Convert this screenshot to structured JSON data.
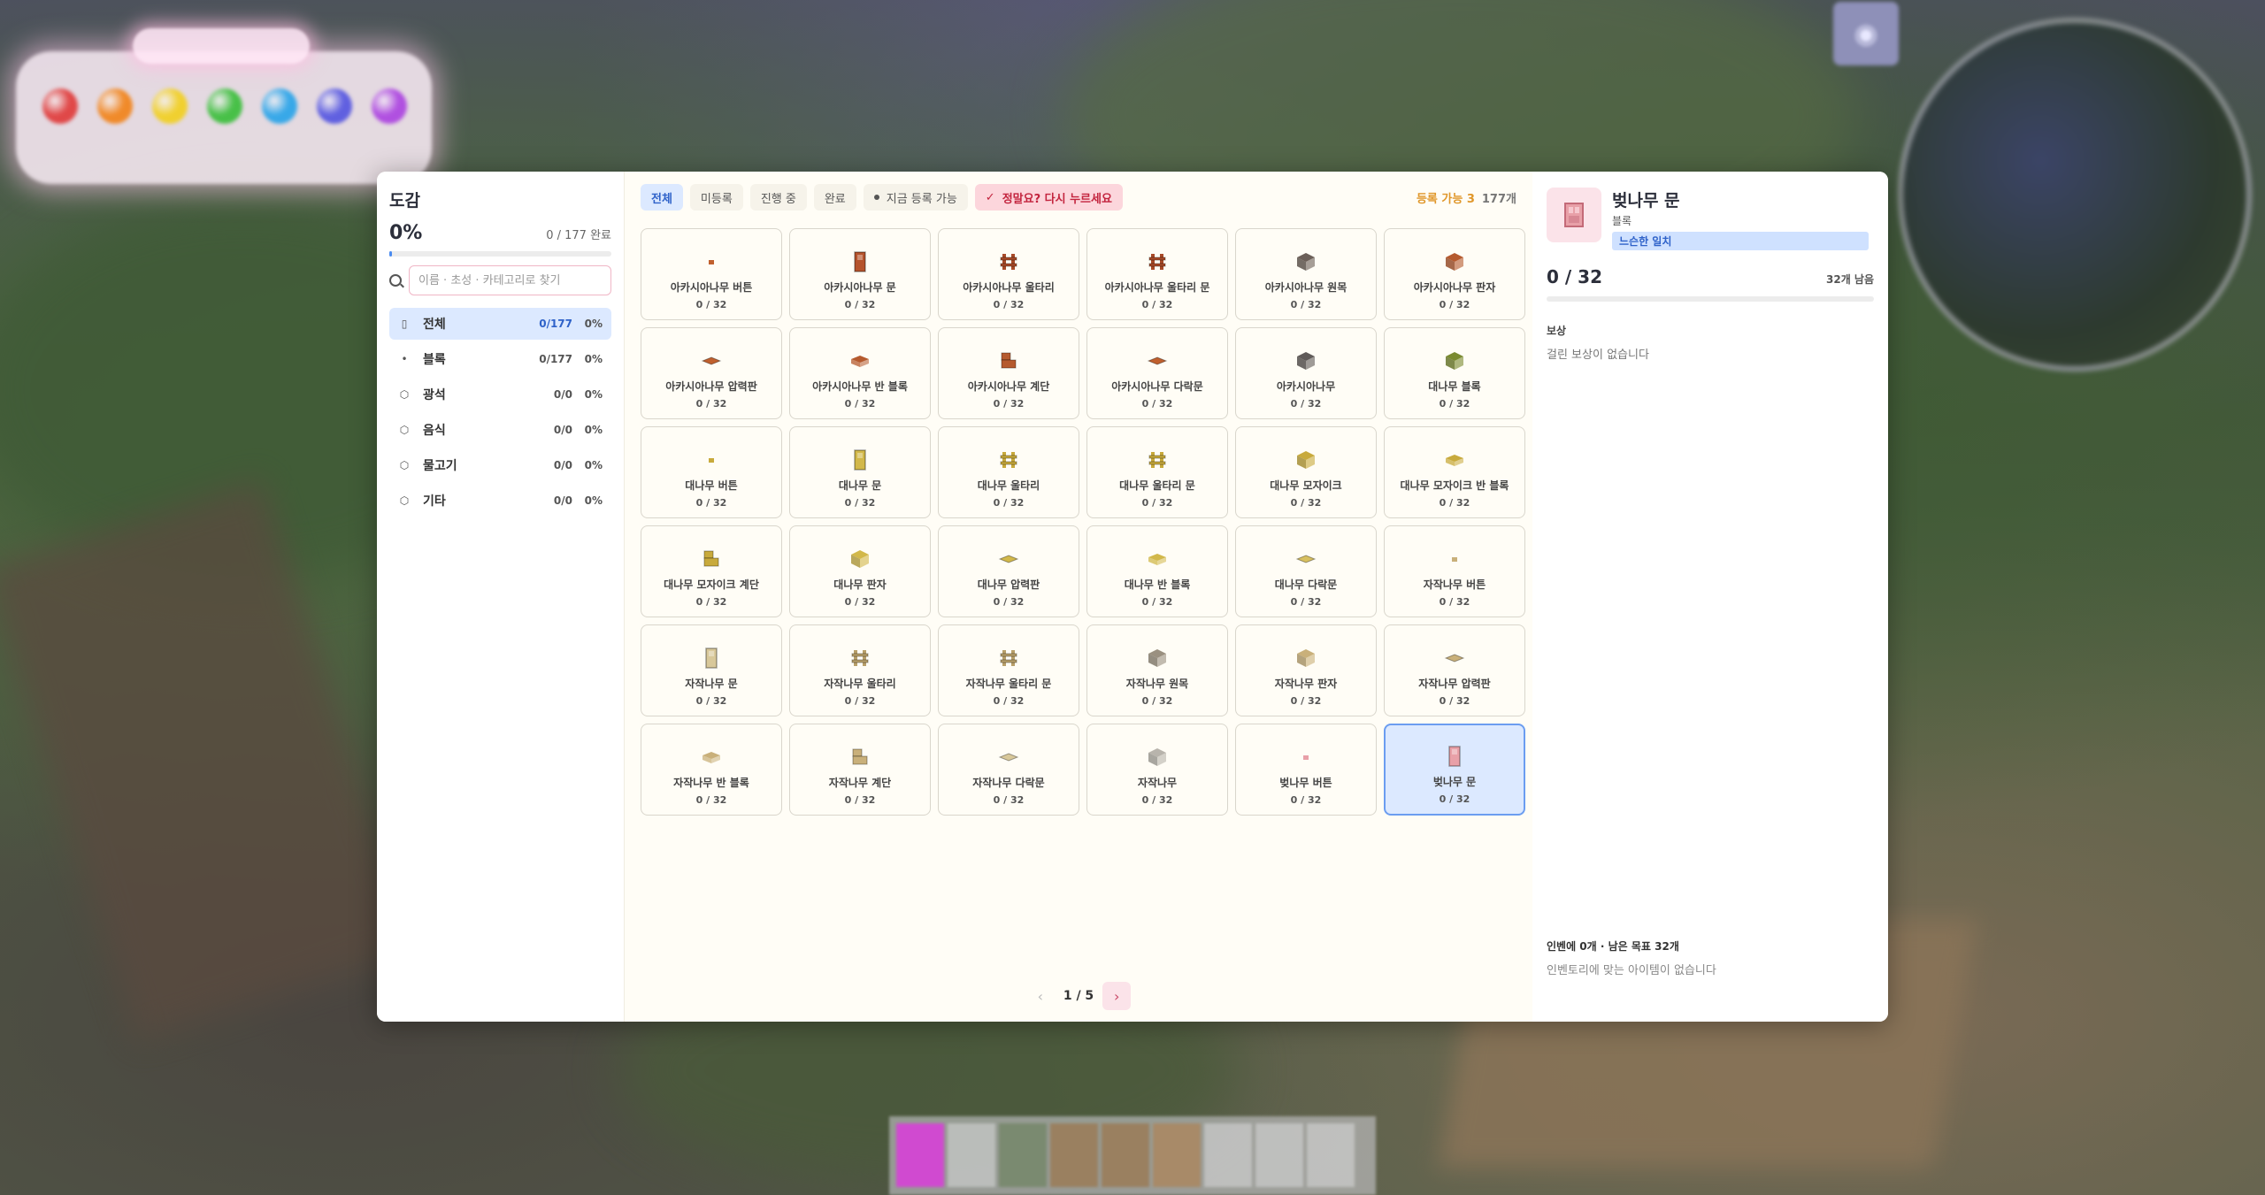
{
  "sidebar": {
    "title": "도감",
    "percent": "0%",
    "complete_text": "0 / 177 완료",
    "progress_fraction": 0.0,
    "search_placeholder": "이름 · 초성 · 카테고리로 찾기",
    "categories": [
      {
        "label": "전체",
        "count": "0/177",
        "pct": "0%",
        "icon": "book-icon",
        "active": true
      },
      {
        "label": "블록",
        "count": "0/177",
        "pct": "0%",
        "icon": "dot-icon"
      },
      {
        "label": "광석",
        "count": "0/0",
        "pct": "0%",
        "icon": "cube-icon"
      },
      {
        "label": "음식",
        "count": "0/0",
        "pct": "0%",
        "icon": "cube-icon"
      },
      {
        "label": "물고기",
        "count": "0/0",
        "pct": "0%",
        "icon": "cube-icon"
      },
      {
        "label": "기타",
        "count": "0/0",
        "pct": "0%",
        "icon": "cube-icon"
      }
    ]
  },
  "filters": {
    "all": "전체",
    "unregistered": "미등록",
    "in_progress": "진행 중",
    "done": "완료",
    "registerable_now": "지금 등록 가능",
    "confirm_warning": "정말요? 다시 누르세요",
    "registerable_info": "등록 가능 3",
    "total_info": "177개"
  },
  "items": [
    {
      "name": "아카시아나무 버튼",
      "progress": "0 / 32",
      "color": "#c0602e",
      "shape": "dot"
    },
    {
      "name": "아카시아나무 문",
      "progress": "0 / 32",
      "color": "#b5532c",
      "shape": "door"
    },
    {
      "name": "아카시아나무 울타리",
      "progress": "0 / 32",
      "color": "#a84a28",
      "shape": "fence"
    },
    {
      "name": "아카시아나무 울타리 문",
      "progress": "0 / 32",
      "color": "#a84a28",
      "shape": "fence"
    },
    {
      "name": "아카시아나무 원목",
      "progress": "0 / 32",
      "color": "#6b5f58",
      "shape": "cube"
    },
    {
      "name": "아카시아나무 판자",
      "progress": "0 / 32",
      "color": "#b55a2e",
      "shape": "cube"
    },
    {
      "name": "아카시아나무 압력판",
      "progress": "0 / 32",
      "color": "#c0602e",
      "shape": "plate"
    },
    {
      "name": "아카시아나무 반 블록",
      "progress": "0 / 32",
      "color": "#b55a2e",
      "shape": "slab"
    },
    {
      "name": "아카시아나무 계단",
      "progress": "0 / 32",
      "color": "#b55a2e",
      "shape": "stairs"
    },
    {
      "name": "아카시아나무 다락문",
      "progress": "0 / 32",
      "color": "#c0602e",
      "shape": "plate"
    },
    {
      "name": "아카시아나무",
      "progress": "0 / 32",
      "color": "#5f5a58",
      "shape": "cube"
    },
    {
      "name": "대나무 블록",
      "progress": "0 / 32",
      "color": "#7a8a30",
      "shape": "cube"
    },
    {
      "name": "대나무 버튼",
      "progress": "0 / 32",
      "color": "#c8aa3c",
      "shape": "dot"
    },
    {
      "name": "대나무 문",
      "progress": "0 / 32",
      "color": "#d2b84a",
      "shape": "door"
    },
    {
      "name": "대나무 울타리",
      "progress": "0 / 32",
      "color": "#c8aa3c",
      "shape": "fence"
    },
    {
      "name": "대나무 울타리 문",
      "progress": "0 / 32",
      "color": "#c8aa3c",
      "shape": "fence"
    },
    {
      "name": "대나무 모자이크",
      "progress": "0 / 32",
      "color": "#c8aa3c",
      "shape": "cube"
    },
    {
      "name": "대나무 모자이크 반 블록",
      "progress": "0 / 32",
      "color": "#c8aa3c",
      "shape": "slab"
    },
    {
      "name": "대나무 모자이크 계단",
      "progress": "0 / 32",
      "color": "#c8aa3c",
      "shape": "stairs"
    },
    {
      "name": "대나무 판자",
      "progress": "0 / 32",
      "color": "#d2b84a",
      "shape": "cube"
    },
    {
      "name": "대나무 압력판",
      "progress": "0 / 32",
      "color": "#d2b84a",
      "shape": "plate"
    },
    {
      "name": "대나무 반 블록",
      "progress": "0 / 32",
      "color": "#d2b84a",
      "shape": "slab"
    },
    {
      "name": "대나무 다락문",
      "progress": "0 / 32",
      "color": "#d8c060",
      "shape": "plate"
    },
    {
      "name": "자작나무 버튼",
      "progress": "0 / 32",
      "color": "#c9b07a",
      "shape": "dot"
    },
    {
      "name": "자작나무 문",
      "progress": "0 / 32",
      "color": "#d8c89a",
      "shape": "door"
    },
    {
      "name": "자작나무 울타리",
      "progress": "0 / 32",
      "color": "#b8a06a",
      "shape": "fence"
    },
    {
      "name": "자작나무 울타리 문",
      "progress": "0 / 32",
      "color": "#b8a06a",
      "shape": "fence"
    },
    {
      "name": "자작나무 원목",
      "progress": "0 / 32",
      "color": "#9a9080",
      "shape": "cube"
    },
    {
      "name": "자작나무 판자",
      "progress": "0 / 32",
      "color": "#c9b07a",
      "shape": "cube"
    },
    {
      "name": "자작나무 압력판",
      "progress": "0 / 32",
      "color": "#c9b07a",
      "shape": "plate"
    },
    {
      "name": "자작나무 반 블록",
      "progress": "0 / 32",
      "color": "#c9b07a",
      "shape": "slab"
    },
    {
      "name": "자작나무 계단",
      "progress": "0 / 32",
      "color": "#c9b07a",
      "shape": "stairs"
    },
    {
      "name": "자작나무 다락문",
      "progress": "0 / 32",
      "color": "#d8c89a",
      "shape": "plate"
    },
    {
      "name": "자작나무",
      "progress": "0 / 32",
      "color": "#b8b4ac",
      "shape": "cube"
    },
    {
      "name": "벚나무 버튼",
      "progress": "0 / 32",
      "color": "#e8a0a8",
      "shape": "dot"
    },
    {
      "name": "벚나무 문",
      "progress": "0 / 32",
      "color": "#e8a0a8",
      "shape": "door",
      "selected": true
    }
  ],
  "pager": {
    "label": "1 / 5"
  },
  "detail": {
    "title": "벚나무 문",
    "subtitle": "블록",
    "badge": "느슨한 일치",
    "progress": "0 / 32",
    "remaining": "32개 남음",
    "reward_heading": "보상",
    "reward_text": "걸린 보상이 없습니다",
    "inventory_status": "인벤에 0개 · 남은 목표 32개",
    "inventory_empty": "인벤토리에 맞는 아이템이 없습니다",
    "icon_color": "#e8a0a8"
  },
  "hud": {
    "orb_colors": [
      "#e04848",
      "#f08a2a",
      "#f0d030",
      "#48c048",
      "#38a8e8",
      "#6060e0",
      "#b050e0"
    ]
  }
}
